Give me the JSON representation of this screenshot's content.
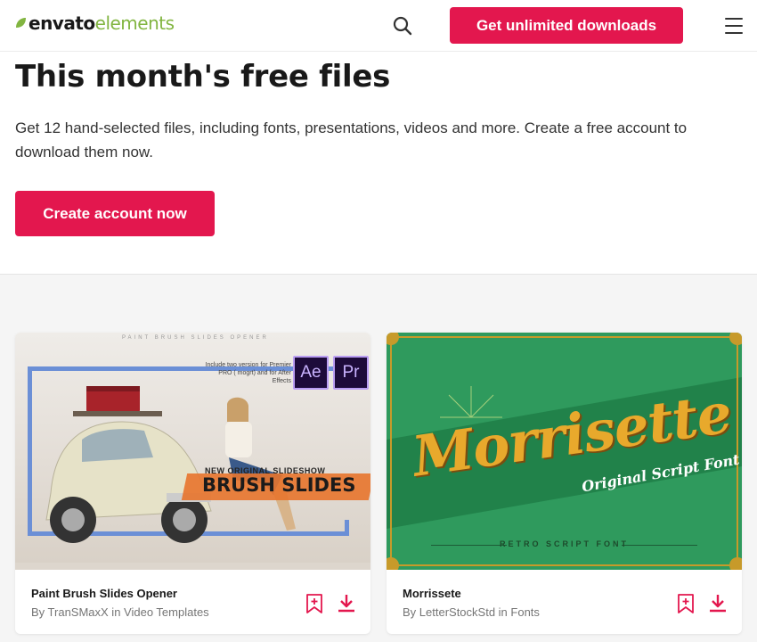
{
  "header": {
    "logo_main": "envato",
    "logo_accent": "elements",
    "cta_label": "Get unlimited downloads"
  },
  "hero": {
    "title": "This month's free files",
    "description": "Get 12 hand-selected files, including fonts, presentations, videos and more. Create a free account to download them now.",
    "button_label": "Create account now"
  },
  "cards": [
    {
      "title": "Paint Brush Slides Opener",
      "byline": "By TranSMaxX in Video Templates",
      "thumb": {
        "header_text": "PAINT BRUSH SLIDES OPENER",
        "note": "Include two version for Premier PRO ( mogrt) and for After Effects",
        "badge_ae": "Ae",
        "badge_pr": "Pr",
        "small_text": "NEW ORIGINAL SLIDESHOW",
        "big_text": "BRUSH SLIDES"
      }
    },
    {
      "title": "Morrissete",
      "byline": "By LetterStockStd in Fonts",
      "thumb": {
        "script_text": "Morrisette",
        "sub_text": "Original Script Font",
        "retro_text": "RETRO SCRIPT FONT"
      }
    }
  ],
  "icons": {
    "search": "search-icon",
    "menu": "hamburger-menu-icon",
    "bookmark": "bookmark-plus-icon",
    "download": "download-icon"
  },
  "colors": {
    "brand_red": "#e3174e",
    "logo_green": "#82b541"
  }
}
